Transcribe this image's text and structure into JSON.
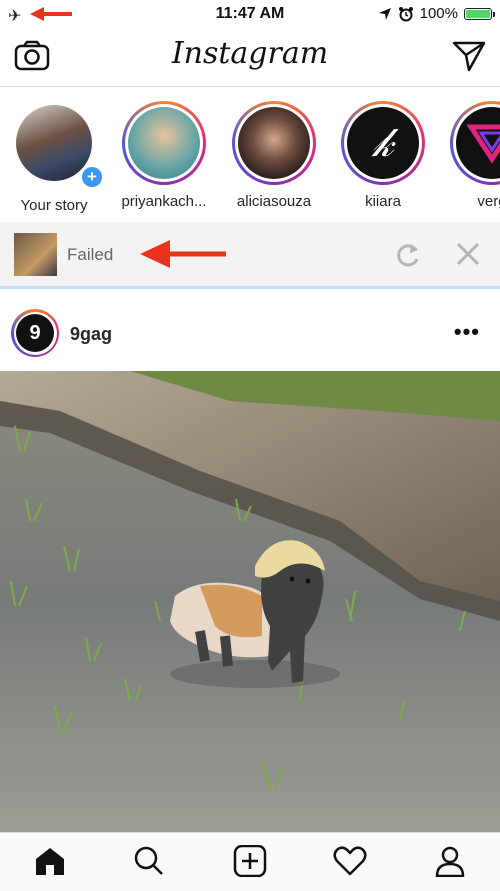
{
  "status_bar": {
    "time": "11:47 AM",
    "battery": "100%",
    "battery_level": 1.0,
    "icons": [
      "airplane-icon",
      "location-icon",
      "alarm-icon",
      "battery-icon"
    ]
  },
  "nav": {
    "logo": "Instagram",
    "icons": [
      "camera-icon",
      "direct-message-icon"
    ]
  },
  "stories": [
    {
      "name": "Your story",
      "has_add": true
    },
    {
      "name": "priyankach..."
    },
    {
      "name": "aliciasouza"
    },
    {
      "name": "kiiara"
    },
    {
      "name": "verg"
    }
  ],
  "upload_status": {
    "label": "Failed",
    "icons": [
      "retry-icon",
      "close-icon"
    ]
  },
  "post": {
    "username": "9gag",
    "avatar_text": "9",
    "more": "•••"
  },
  "tab_bar": {
    "icons": [
      "home-icon",
      "search-icon",
      "new-post-icon",
      "activity-heart-icon",
      "profile-icon"
    ]
  },
  "colors": {
    "accent_blue": "#3897f0",
    "annotation_red": "#e8341c",
    "battery_green": "#4cd964"
  }
}
